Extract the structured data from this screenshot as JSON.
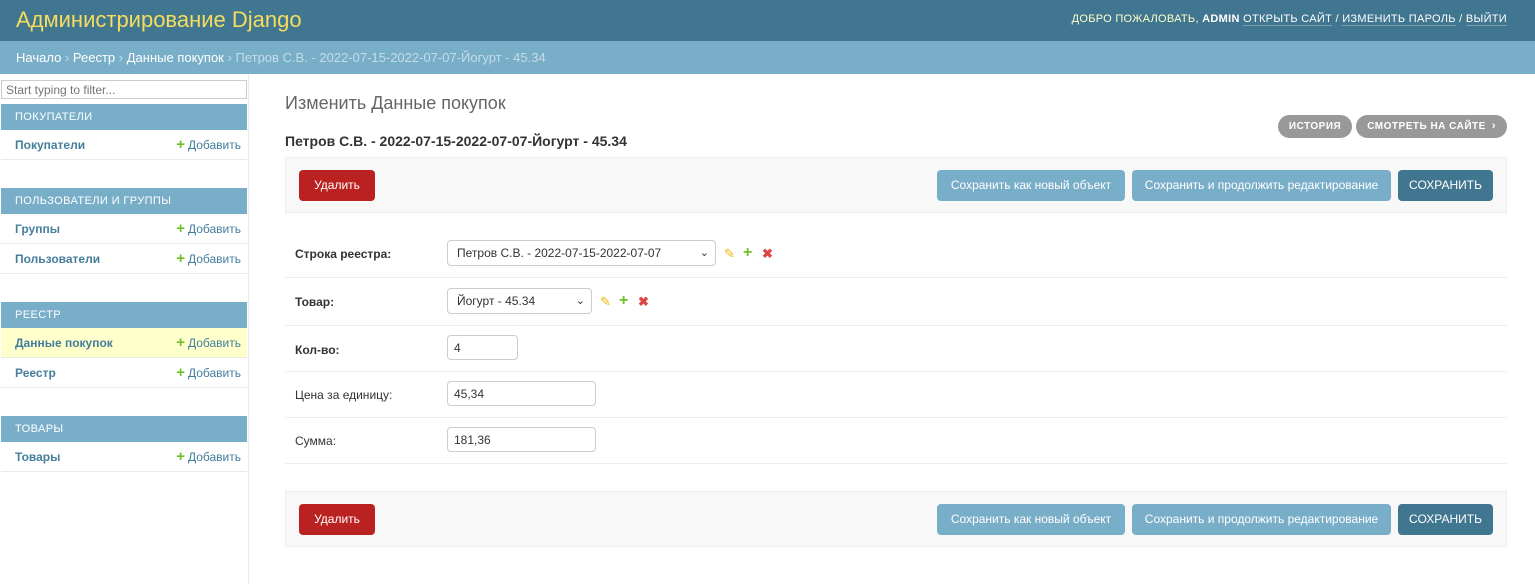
{
  "header": {
    "branding": "Администрирование Django",
    "welcome": "Добро пожаловать,",
    "username": "admin",
    "view_site": "Открыть сайт",
    "change_password": "Изменить пароль",
    "logout": "Выйти",
    "separator": "/"
  },
  "breadcrumbs": {
    "home": "Начало",
    "app": "Реестр",
    "model": "Данные покупок",
    "current": "Петров С.В. - 2022-07-15-2022-07-07-Йогурт - 45.34",
    "sep": "›"
  },
  "sidebar": {
    "filter_placeholder": "Start typing to filter...",
    "add_label": "Добавить",
    "modules": [
      {
        "caption": "Покупатели",
        "rows": [
          {
            "name": "Покупатели"
          }
        ]
      },
      {
        "caption": "Пользователи и группы",
        "rows": [
          {
            "name": "Группы"
          },
          {
            "name": "Пользователи"
          }
        ]
      },
      {
        "caption": "Реестр",
        "rows": [
          {
            "name": "Данные покупок",
            "current": true
          },
          {
            "name": "Реестр"
          }
        ]
      },
      {
        "caption": "Товары",
        "rows": [
          {
            "name": "Товары"
          }
        ]
      }
    ]
  },
  "content": {
    "title": "Изменить Данные покупок",
    "object_title": "Петров С.В. - 2022-07-15-2022-07-07-Йогурт - 45.34",
    "history": "История",
    "view_on_site": "Смотреть на сайте"
  },
  "submit": {
    "delete": "Удалить",
    "save_as_new": "Сохранить как новый объект",
    "save_continue": "Сохранить и продолжить редактирование",
    "save": "Сохранить"
  },
  "form": {
    "registry_row": {
      "label": "Строка реестра:",
      "value": "Петров С.В. - 2022-07-15-2022-07-07"
    },
    "product": {
      "label": "Товар:",
      "value": "Йогурт - 45.34"
    },
    "quantity": {
      "label": "Кол-во:",
      "value": "4"
    },
    "unit_price": {
      "label": "Цена за единицу:",
      "value": "45,34"
    },
    "total": {
      "label": "Сумма:",
      "value": "181,36"
    }
  },
  "icons": {
    "add": "+",
    "edit": "✎",
    "delete": "✖",
    "caret": "⌄",
    "chevron": "›"
  },
  "colors": {
    "header_bg": "#417690",
    "branding": "#f5dd5d",
    "breadcrumbs_bg": "#79aec8",
    "delete_button": "#ba2121",
    "save_button": "#417690",
    "secondary_button": "#79aec8",
    "current_row": "#ffffcc",
    "add_icon": "#70bf2b"
  }
}
